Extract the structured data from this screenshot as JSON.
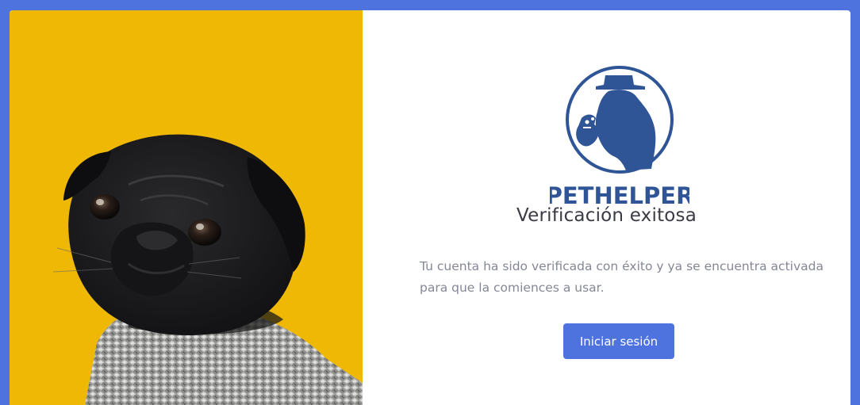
{
  "hero_image": {
    "subject": "black pug wearing a knitted sweater",
    "background_color": "#efb805"
  },
  "logo": {
    "brand_name": "PETHELPER",
    "color": "#2f5597"
  },
  "verification": {
    "title": "Verificación exitosa",
    "message": "Tu cuenta ha sido verificada con éxito y ya se encuentra activada para que la comiences a usar.",
    "login_button_label": "Iniciar sesión"
  },
  "colors": {
    "accent": "#4e73df",
    "title_text": "#3a3b45",
    "body_text": "#858796"
  }
}
